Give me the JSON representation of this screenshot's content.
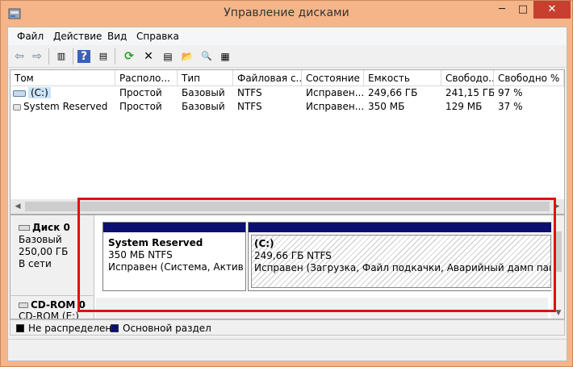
{
  "window": {
    "title": "Управление дисками",
    "min_glyph": "─",
    "max_glyph": "□",
    "close_glyph": "✕"
  },
  "menu": [
    "Файл",
    "Действие",
    "Вид",
    "Справка"
  ],
  "toolbar": {
    "back_glyph": "⇦",
    "forward_glyph": "⇨",
    "help_glyph": "?",
    "refresh_glyph": "⟳",
    "delete_glyph": "✕",
    "properties_glyph": "▤",
    "open_glyph": "📂",
    "search_glyph": "🔍",
    "settings_glyph": "▦"
  },
  "volume_table": {
    "headers": [
      "Том",
      "Располо...",
      "Тип",
      "Файловая с...",
      "Состояние",
      "Емкость",
      "Свободо...",
      "Свободно %"
    ],
    "rows": [
      [
        "(C:)",
        "Простой",
        "Базовый",
        "NTFS",
        "Исправен...",
        "249,66 ГБ",
        "241,15 ГБ",
        "97 %"
      ],
      [
        "System Reserved",
        "Простой",
        "Базовый",
        "NTFS",
        "Исправен...",
        "350 МБ",
        "129 МБ",
        "37 %"
      ]
    ]
  },
  "disk0": {
    "name": "Диск 0",
    "type": "Базовый",
    "size": "250,00 ГБ",
    "status": "В сети",
    "partitions": [
      {
        "title": "System Reserved",
        "size": "350 МБ NTFS",
        "status": "Исправен (Система, Активен,"
      },
      {
        "title": "(C:)",
        "size": "249,66 ГБ NTFS",
        "status": "Исправен (Загрузка, Файл подкачки, Аварийный дамп памяти, Ос"
      }
    ]
  },
  "cdrom": {
    "name": "CD-ROM 0",
    "drive": "CD-ROM (E:)"
  },
  "legend": [
    {
      "label": "Не распределена",
      "color": "#000000"
    },
    {
      "label": "Основной раздел",
      "color": "#0b1071"
    }
  ],
  "scroll": {
    "left": "◀",
    "right": "▶",
    "down": "▼"
  },
  "colors": {
    "highlight": "#e01010",
    "partition_bar": "#0b1071",
    "titlebar": "#f5b589"
  }
}
